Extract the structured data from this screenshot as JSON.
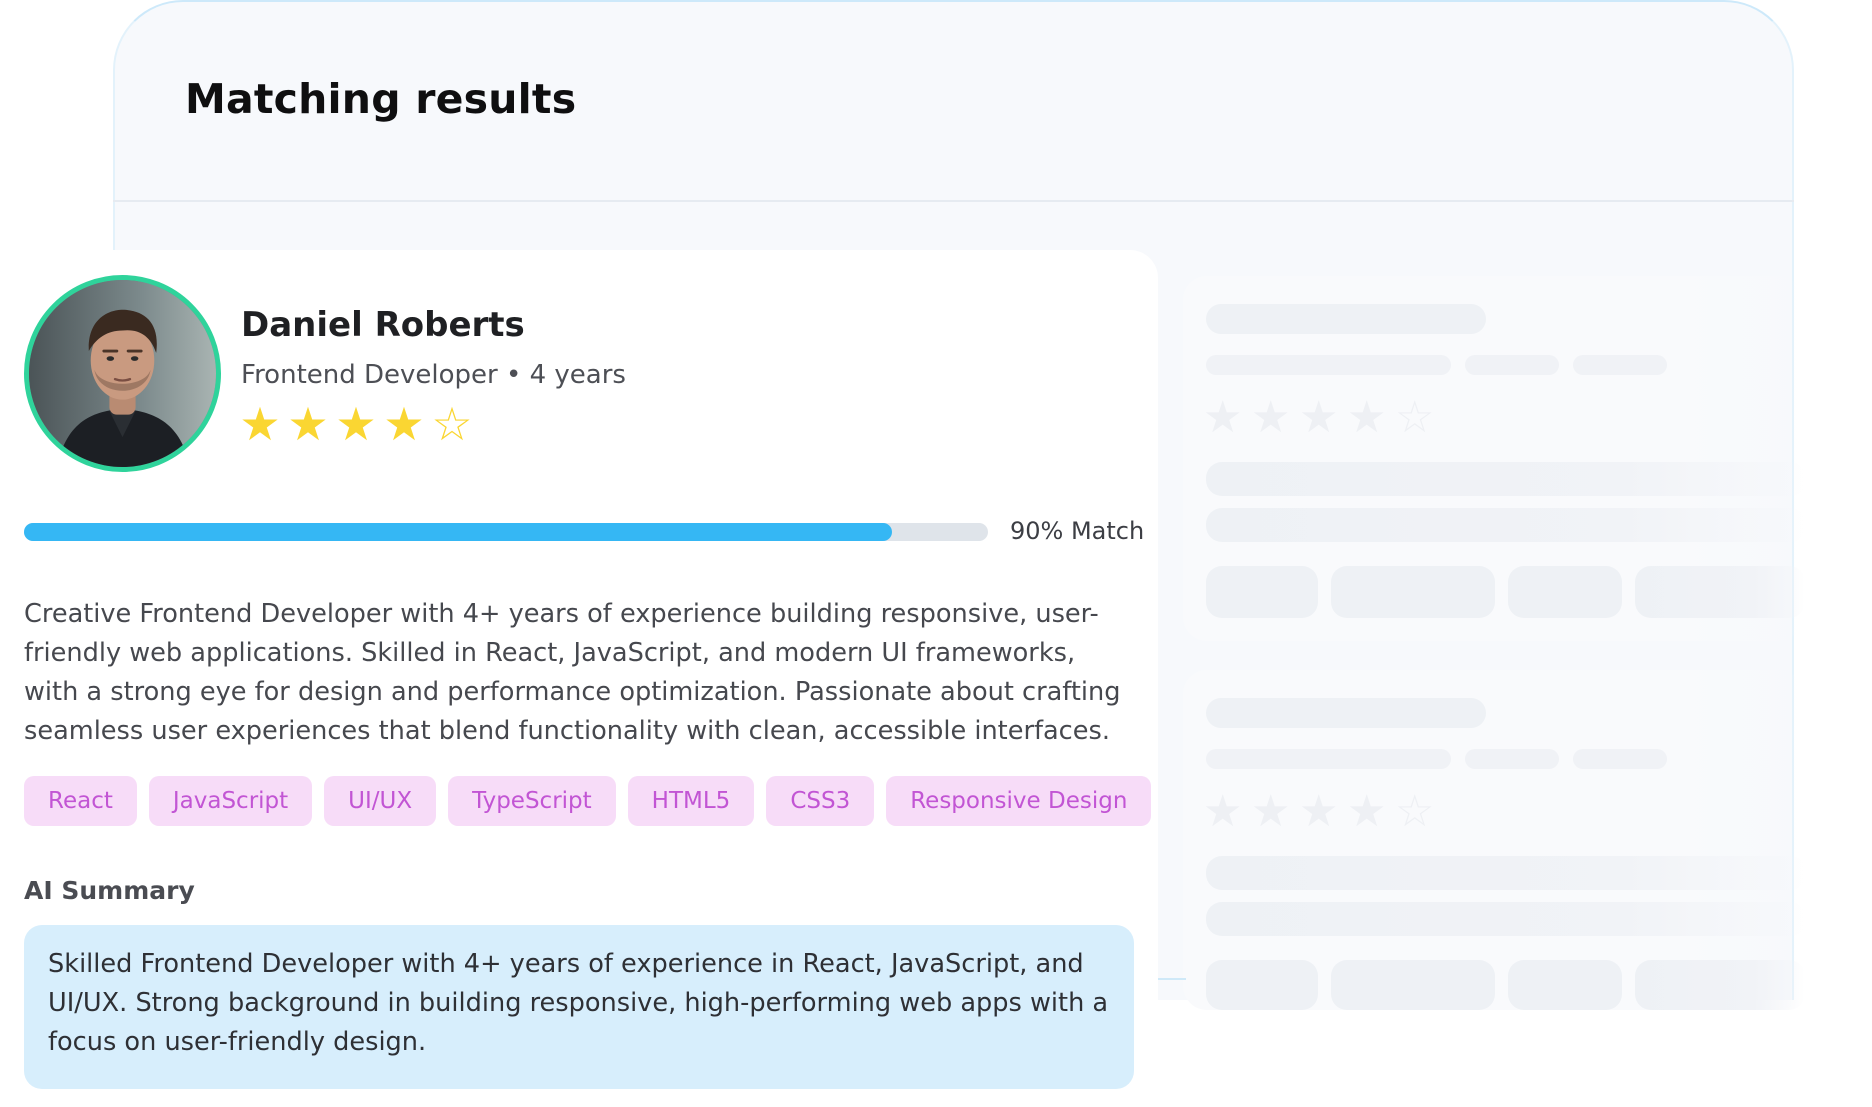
{
  "panel": {
    "title": "Matching results"
  },
  "candidate": {
    "name": "Daniel Roberts",
    "role": "Frontend Developer",
    "separator": "•",
    "experience": "4 years",
    "rating": 4,
    "rating_max": 5,
    "match_percent": 90,
    "match_label": "90% Match",
    "description": "Creative Frontend Developer with 4+ years of experience building responsive, user-friendly web applications. Skilled in React, JavaScript, and modern UI frameworks, with a strong eye for design and performance optimization. Passionate about crafting seamless user experiences that blend functionality with clean, accessible interfaces.",
    "skills": [
      "React",
      "JavaScript",
      "UI/UX",
      "TypeScript",
      "HTML5",
      "CSS3",
      "Responsive Design"
    ],
    "ai_summary_title": "AI Summary",
    "ai_summary": "Skilled Frontend Developer with 4+ years of experience in React, JavaScript, and UI/UX. Strong background in building responsive, high-performing web apps with a focus on user-friendly design."
  },
  "icons": {
    "star_filled": "star-filled-icon",
    "star_empty": "star-outline-icon",
    "avatar": "avatar-photo"
  },
  "colors": {
    "accent_progress": "#35b7f4",
    "avatar_ring": "#2fd39b",
    "star": "#fad632",
    "tag_bg": "#f7dcf8",
    "tag_text": "#c255d4",
    "summary_bg": "#d7eefc"
  }
}
